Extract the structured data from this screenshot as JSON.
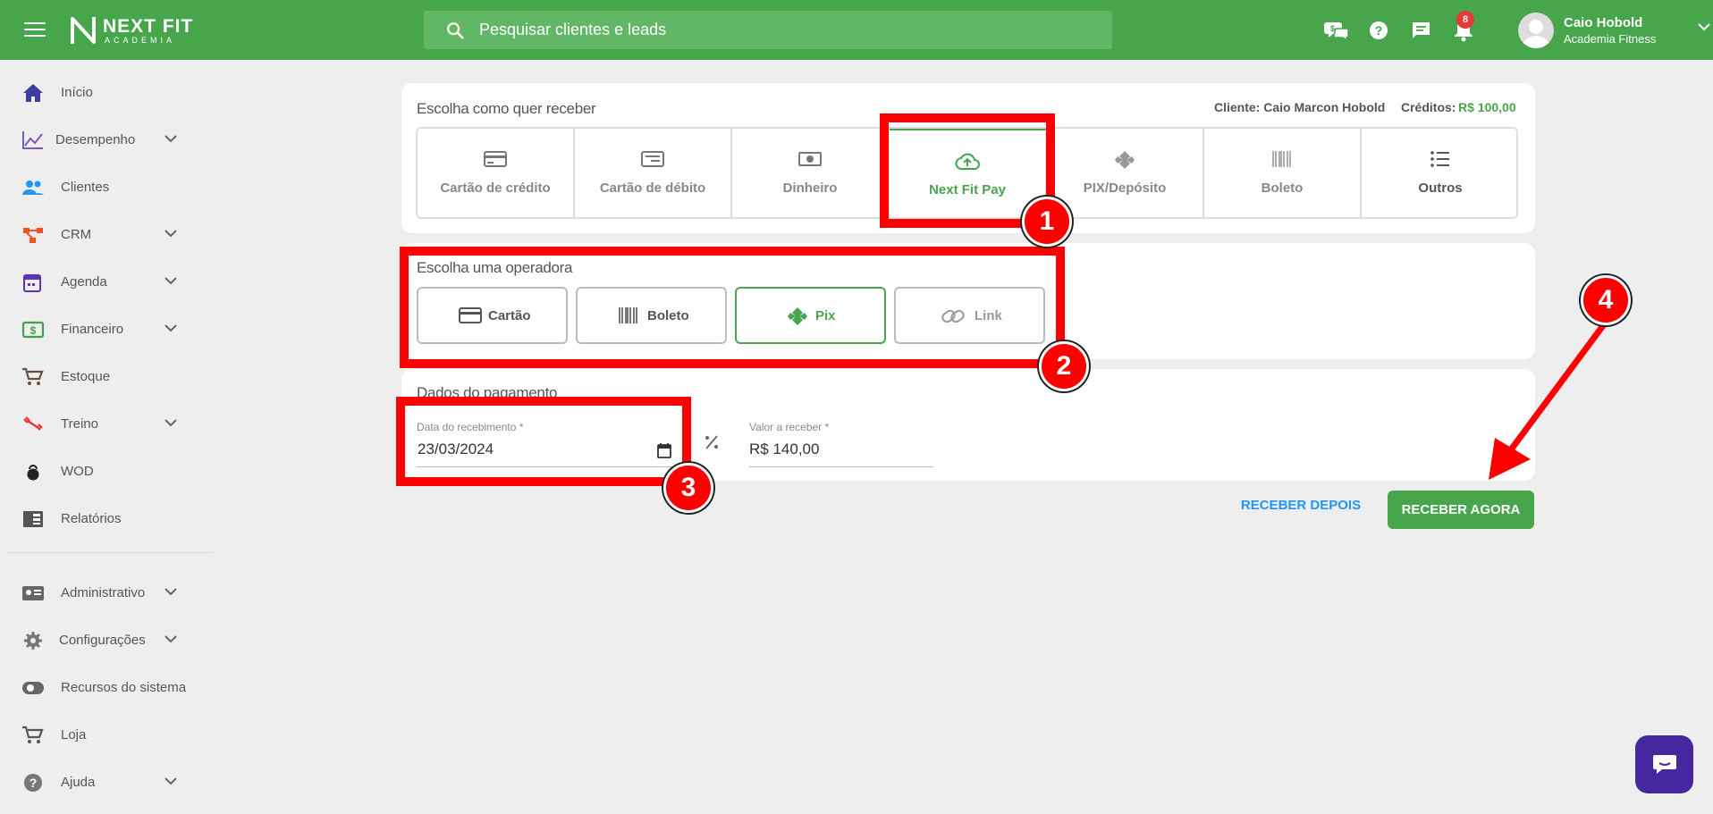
{
  "header": {
    "brand_line1": "NEXT FIT",
    "brand_line2": "ACADEMIA",
    "search_placeholder": "Pesquisar clientes e leads",
    "notification_count": "8",
    "user_name": "Caio Hobold",
    "user_org": "Academia Fitness"
  },
  "sidebar": {
    "items": [
      {
        "label": "Início",
        "icon": "home-icon",
        "has_children": false
      },
      {
        "label": "Desempenho",
        "icon": "chart-line-icon",
        "has_children": true
      },
      {
        "label": "Clientes",
        "icon": "people-icon",
        "has_children": false
      },
      {
        "label": "CRM",
        "icon": "crm-icon",
        "has_children": true
      },
      {
        "label": "Agenda",
        "icon": "calendar-icon",
        "has_children": true
      },
      {
        "label": "Financeiro",
        "icon": "money-icon",
        "has_children": true
      },
      {
        "label": "Estoque",
        "icon": "cart-icon",
        "has_children": false
      },
      {
        "label": "Treino",
        "icon": "dumbbell-icon",
        "has_children": true
      },
      {
        "label": "WOD",
        "icon": "kettlebell-icon",
        "has_children": false
      },
      {
        "label": "Relatórios",
        "icon": "report-icon",
        "has_children": false
      },
      {
        "label": "Administrativo",
        "icon": "id-card-icon",
        "has_children": true
      },
      {
        "label": "Configurações",
        "icon": "gear-icon",
        "has_children": true
      },
      {
        "label": "Recursos do sistema",
        "icon": "toggle-icon",
        "has_children": false
      },
      {
        "label": "Loja",
        "icon": "cart-icon",
        "has_children": false
      },
      {
        "label": "Ajuda",
        "icon": "help-icon",
        "has_children": true
      }
    ]
  },
  "receive": {
    "title": "Escolha como quer receber",
    "client_label": "Cliente: Caio Marcon Hobold",
    "credits_label": "Créditos:",
    "credits_value": "R$ 100,00",
    "methods": [
      {
        "label": "Cartão de crédito",
        "icon": "credit-card-icon",
        "active": false
      },
      {
        "label": "Cartão de débito",
        "icon": "debit-card-icon",
        "active": false
      },
      {
        "label": "Dinheiro",
        "icon": "cash-icon",
        "active": false
      },
      {
        "label": "Next Fit Pay",
        "icon": "cloud-upload-icon",
        "active": true
      },
      {
        "label": "PIX/Depósito",
        "icon": "pix-icon",
        "active": false
      },
      {
        "label": "Boleto",
        "icon": "barcode-icon",
        "active": false
      },
      {
        "label": "Outros",
        "icon": "list-icon",
        "active": false
      }
    ]
  },
  "operator": {
    "title": "Escolha uma operadora",
    "options": [
      {
        "label": "Cartão",
        "icon": "credit-card-icon",
        "selected": false
      },
      {
        "label": "Boleto",
        "icon": "barcode-icon",
        "selected": false
      },
      {
        "label": "Pix",
        "icon": "pix-icon",
        "selected": true
      },
      {
        "label": "Link",
        "icon": "link-icon",
        "selected": false
      }
    ]
  },
  "payment": {
    "title": "Dados do pagamento",
    "date_label": "Data do recebimento *",
    "date_value": "23/03/2024",
    "amount_label": "Valor a receber *",
    "amount_value": "R$ 140,00"
  },
  "actions": {
    "later": "RECEBER DEPOIS",
    "now": "RECEBER AGORA"
  },
  "annotations": {
    "step1": "1",
    "step2": "2",
    "step3": "3",
    "step4": "4"
  },
  "colors": {
    "brand_green": "#47a54c",
    "highlight_red": "#ff0000",
    "link_blue": "#2196f3",
    "chat_purple": "#4527a0"
  }
}
